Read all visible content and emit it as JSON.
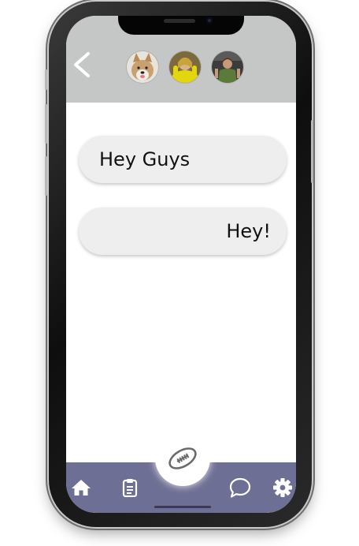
{
  "header": {
    "background": "#c5c7c7",
    "back_icon": "chevron-left-icon",
    "avatars": [
      {
        "name": "avatar-dog",
        "color": "#c9a070"
      },
      {
        "name": "avatar-yellow-jacket",
        "color": "#e2d60e"
      },
      {
        "name": "avatar-green-shirt",
        "color": "#5c7a3a"
      }
    ]
  },
  "messages": [
    {
      "text": "Hey Guys",
      "align": "left"
    },
    {
      "text": "Hey!",
      "align": "right"
    }
  ],
  "navbar": {
    "background": "#6e6f94",
    "icons": [
      "home-icon",
      "clipboard-icon",
      "football-icon",
      "chat-bubble-icon",
      "gear-icon"
    ]
  }
}
